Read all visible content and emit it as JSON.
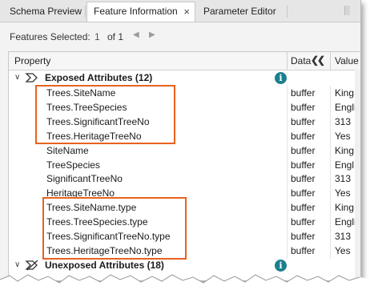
{
  "tabs": [
    {
      "label": "Schema Preview",
      "active": false
    },
    {
      "label": "Feature Information",
      "active": true,
      "close": "×"
    },
    {
      "label": "Parameter Editor",
      "active": false
    }
  ],
  "toolbar": {
    "features_selected_label": "Features Selected:",
    "selected_count": "1",
    "of_total": "of 1",
    "prev_icon": "triangle-left-icon",
    "next_icon": "triangle-right-icon"
  },
  "columns": {
    "property": "Property",
    "data": "Data",
    "value": "Value",
    "collapse_glyph": "❮❮"
  },
  "groups": {
    "exposed": {
      "title": "Exposed Attributes (12)",
      "info": "i"
    },
    "unexposed": {
      "title": "Unexposed Attributes (18)",
      "info": "i"
    }
  },
  "rows": [
    {
      "property": "Trees.SiteName",
      "data": "buffer",
      "value": "King"
    },
    {
      "property": "Trees.TreeSpecies",
      "data": "buffer",
      "value": "English"
    },
    {
      "property": "Trees.SignificantTreeNo",
      "data": "buffer",
      "value": "313"
    },
    {
      "property": "Trees.HeritageTreeNo",
      "data": "buffer",
      "value": "Yes"
    },
    {
      "property": "SiteName",
      "data": "buffer",
      "value": "King"
    },
    {
      "property": "TreeSpecies",
      "data": "buffer",
      "value": "Engl"
    },
    {
      "property": "SignificantTreeNo",
      "data": "buffer",
      "value": "313"
    },
    {
      "property": "HeritageTreeNo",
      "data": "buffer",
      "value": "Yes"
    },
    {
      "property": "Trees.SiteName.type",
      "data": "buffer",
      "value": "King Ge"
    },
    {
      "property": "Trees.TreeSpecies.type",
      "data": "buffer",
      "value": "Englisi"
    },
    {
      "property": "Trees.SignificantTreeNo.type",
      "data": "buffer",
      "value": "313"
    },
    {
      "property": "Trees.HeritageTreeNo.type",
      "data": "buffer",
      "value": "Yes"
    }
  ],
  "colors": {
    "highlight": "#e8621f",
    "info_badge": "#1a7f8e"
  }
}
